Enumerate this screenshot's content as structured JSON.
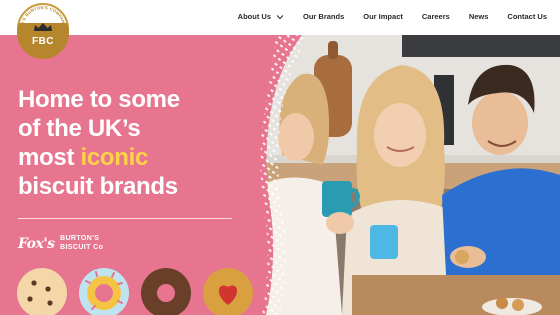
{
  "header": {
    "logo": {
      "initials": "FBC",
      "arc_text": "FOX'S BURTON'S COMPANIES",
      "icon": "crown-icon",
      "color": "#b5862c"
    },
    "nav": [
      {
        "label": "About Us",
        "has_dropdown": true
      },
      {
        "label": "Our Brands"
      },
      {
        "label": "Our Impact"
      },
      {
        "label": "Careers"
      },
      {
        "label": "News"
      },
      {
        "label": "Contact Us"
      }
    ]
  },
  "hero": {
    "headline": {
      "line1": "Home to some",
      "line2": "of the UK’s",
      "line3_plain": "most ",
      "line3_accent": "iconic",
      "line4": "biscuit brands"
    },
    "brands": {
      "fox": "Fox's",
      "burtons_line1": "BURTON'S",
      "burtons_line2": "BISCUIT Co"
    },
    "colors": {
      "background": "#e8758f",
      "accent_text": "#ffd24a",
      "text": "#ffffff"
    },
    "biscuit_icons": [
      "cookie-icon",
      "iced-ring-icon",
      "jammie-ring-icon",
      "heart-biscuit-icon"
    ]
  }
}
